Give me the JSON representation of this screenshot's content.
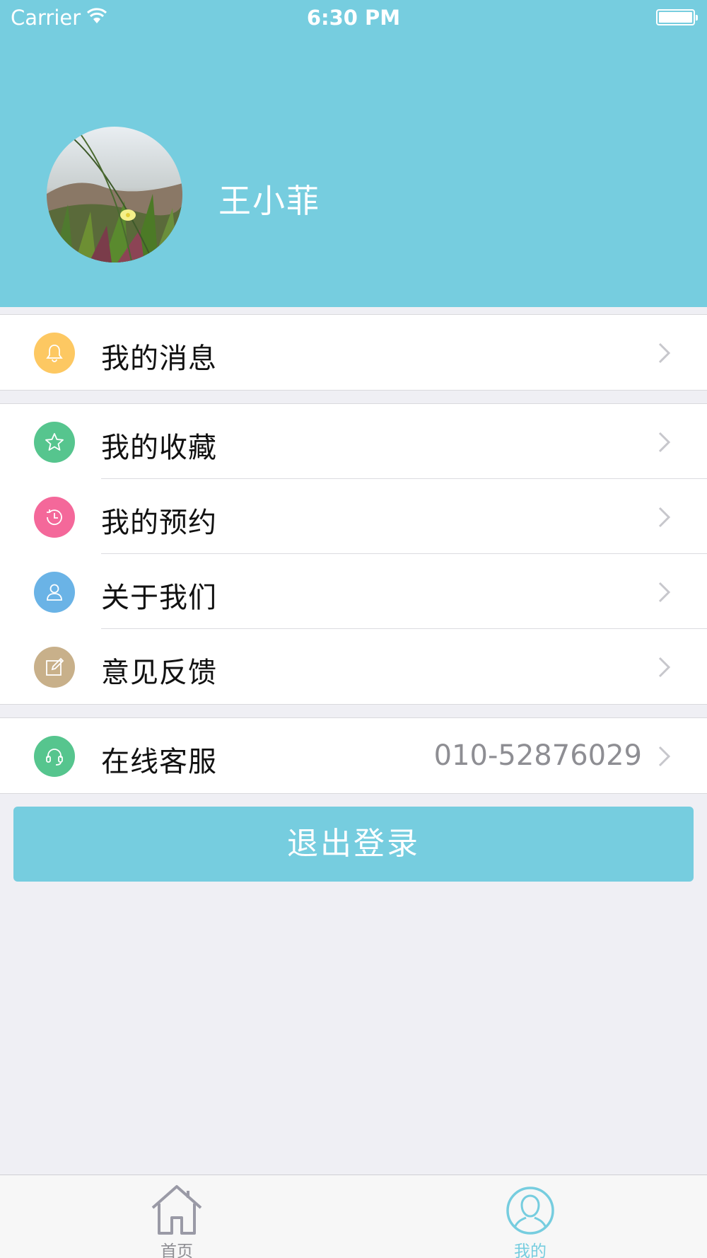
{
  "status_bar": {
    "carrier": "Carrier",
    "time": "6:30 PM",
    "battery": "full"
  },
  "profile": {
    "name": "王小菲",
    "avatar": "flower-photo-avatar"
  },
  "section1": [
    {
      "label": "我的消息",
      "icon": "bell-icon",
      "color": "#fdc862"
    }
  ],
  "section2": [
    {
      "label": "我的收藏",
      "icon": "star-icon",
      "color": "#56c58e"
    },
    {
      "label": "我的预约",
      "icon": "clock-history-icon",
      "color": "#f4689a"
    },
    {
      "label": "关于我们",
      "icon": "person-icon",
      "color": "#6ab3e6"
    },
    {
      "label": "意见反馈",
      "icon": "edit-icon",
      "color": "#c8b08a"
    }
  ],
  "section3": [
    {
      "label": "在线客服",
      "icon": "headset-icon",
      "color": "#56c58e",
      "value": "010-52876029"
    }
  ],
  "logout_label": "退出登录",
  "tabs": [
    {
      "label": "首页",
      "icon": "home-icon",
      "active": false
    },
    {
      "label": "我的",
      "icon": "profile-icon",
      "active": true
    }
  ],
  "colors": {
    "accent": "#76cddf",
    "background": "#efeff4"
  }
}
